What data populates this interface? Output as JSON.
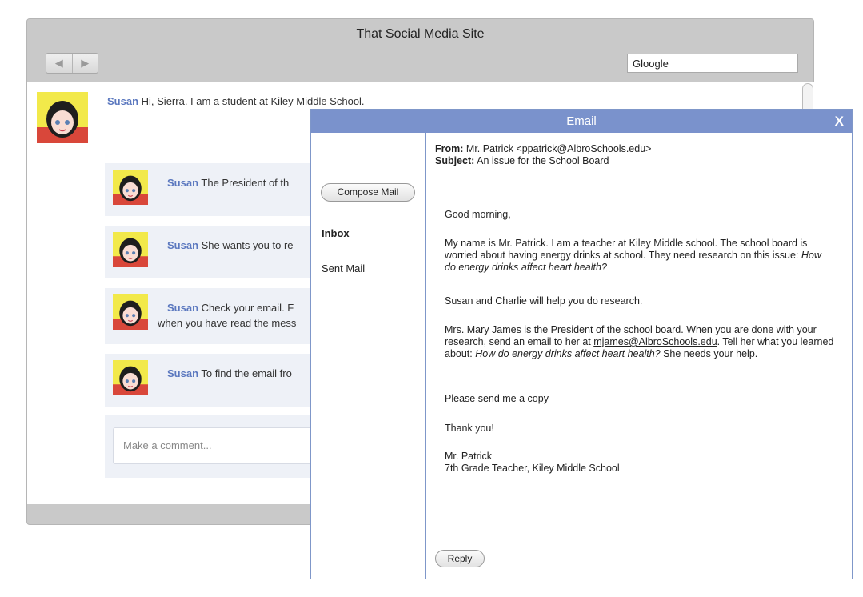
{
  "window": {
    "title": "That Social Media Site",
    "back_icon": "◀",
    "forward_icon": "▶",
    "search_value": "Gloogle"
  },
  "post": {
    "author": "Susan",
    "text": "Hi, Sierra. I am a student at Kiley Middle School."
  },
  "comments": [
    {
      "author": "Susan",
      "text": "The President of th"
    },
    {
      "author": "Susan",
      "text": "She wants you to re"
    },
    {
      "author": "Susan",
      "text": "Check your email. F",
      "text2": "when you have read the mess"
    },
    {
      "author": "Susan",
      "text": "To find the email fro"
    }
  ],
  "comment_input": {
    "placeholder": "Make a comment..."
  },
  "email": {
    "header": "Email",
    "close_label": "X",
    "compose_label": "Compose Mail",
    "inbox_label": "Inbox",
    "sent_label": "Sent Mail",
    "from_label": "From:",
    "from_value": "Mr. Patrick  <ppatrick@AlbroSchools.edu>",
    "subject_label": "Subject:",
    "subject_value": "An issue for the School Board",
    "greeting": "Good morning,",
    "p1_a": "My name is Mr. Patrick. I am a teacher at Kiley Middle school. The school board is worried about having energy drinks at school. They need research on this issue: ",
    "p1_b": "How do energy drinks affect heart health?",
    "p2": "Susan and Charlie will help you do research.",
    "p3_a": "Mrs. Mary James is the President of the school board. When you are done with your research, send an email to her at ",
    "p3_link": "mjames@AlbroSchools.edu",
    "p3_b": ". Tell her what you learned about: ",
    "p3_c": "How do energy drinks affect heart health?",
    "p3_d": " She needs your help.",
    "copy_link": "Please send me a copy",
    "thanks": "Thank you!",
    "sig_name": "Mr. Patrick",
    "sig_title": "7th Grade Teacher, Kiley Middle School",
    "reply_label": "Reply"
  },
  "colors": {
    "accent": "#7a92cc",
    "name": "#5b78bf",
    "comment_bg": "#eef1f7"
  }
}
